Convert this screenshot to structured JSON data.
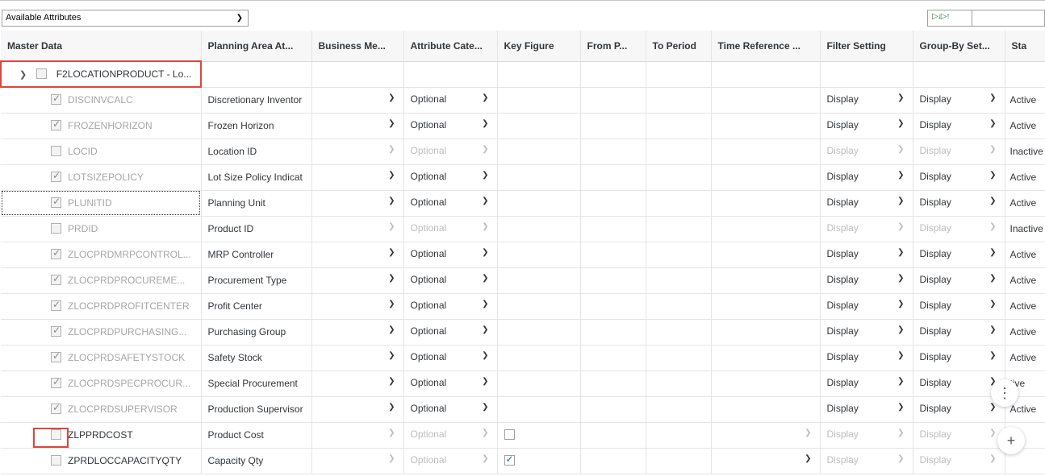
{
  "toolbar": {
    "dropdown_value": "Available Attributes",
    "sort_icon_label": "sort-ascending-descending-icon"
  },
  "columns": [
    "Master Data",
    "Planning Area At...",
    "Business Me...",
    "Attribute Cate...",
    "Key Figure",
    "From P...",
    "To Period",
    "Time Reference ...",
    "Filter Setting",
    "Group-By Set...",
    "Sta"
  ],
  "root": {
    "label": "F2LOCATIONPRODUCT - Lo..."
  },
  "rows": [
    {
      "name": "DISCINVCALC",
      "desc": "Discretionary Inventor",
      "category": "Optional",
      "filter": "Display",
      "groupby": "Display",
      "status": "Active"
    },
    {
      "name": "FROZENHORIZON",
      "desc": "Frozen Horizon",
      "category": "Optional",
      "filter": "Display",
      "groupby": "Display",
      "status": "Active"
    },
    {
      "name": "LOCID",
      "desc": "Location ID",
      "category": "Optional",
      "filter": "Display",
      "groupby": "Display",
      "status": "Inactive"
    },
    {
      "name": "LOTSIZEPOLICY",
      "desc": "Lot Size Policy Indicat",
      "category": "Optional",
      "filter": "Display",
      "groupby": "Display",
      "status": "Active"
    },
    {
      "name": "PLUNITID",
      "desc": "Planning Unit",
      "category": "Optional",
      "filter": "Display",
      "groupby": "Display",
      "status": "Active"
    },
    {
      "name": "PRDID",
      "desc": "Product ID",
      "category": "Optional",
      "filter": "Display",
      "groupby": "Display",
      "status": "Inactive"
    },
    {
      "name": "ZLOCPRDMRPCONTROL...",
      "desc": "MRP Controller",
      "category": "Optional",
      "filter": "Display",
      "groupby": "Display",
      "status": "Active"
    },
    {
      "name": "ZLOCPRDPROCUREME...",
      "desc": "Procurement Type",
      "category": "Optional",
      "filter": "Display",
      "groupby": "Display",
      "status": "Active"
    },
    {
      "name": "ZLOCPRDPROFITCENTER",
      "desc": "Profit Center",
      "category": "Optional",
      "filter": "Display",
      "groupby": "Display",
      "status": "Active"
    },
    {
      "name": "ZLOCPRDPURCHASING...",
      "desc": "Purchasing Group",
      "category": "Optional",
      "filter": "Display",
      "groupby": "Display",
      "status": "Active"
    },
    {
      "name": "ZLOCPRDSAFETYSTOCK",
      "desc": "Safety Stock",
      "category": "Optional",
      "filter": "Display",
      "groupby": "Display",
      "status": "Active"
    },
    {
      "name": "ZLOCPRDSPECPROCUR...",
      "desc": "Special Procurement",
      "category": "Optional",
      "filter": "Display",
      "groupby": "Display",
      "status": "tive"
    },
    {
      "name": "ZLOCPRDSUPERVISOR",
      "desc": "Production Supervisor",
      "category": "Optional",
      "filter": "Display",
      "groupby": "Display",
      "status": "Active"
    },
    {
      "name": "ZLPPRDCOST",
      "desc": "Product Cost",
      "category": "Optional",
      "filter": "Display",
      "groupby": "Display",
      "status": ""
    },
    {
      "name": "ZPRDLOCCAPACITYQTY",
      "desc": "Capacity Qty",
      "category": "Optional",
      "filter": "Display",
      "groupby": "Display",
      "status": ""
    }
  ],
  "floating": {
    "collapse_icon": "collapse-icon",
    "add_icon": "plus-icon",
    "add_label": "+"
  }
}
